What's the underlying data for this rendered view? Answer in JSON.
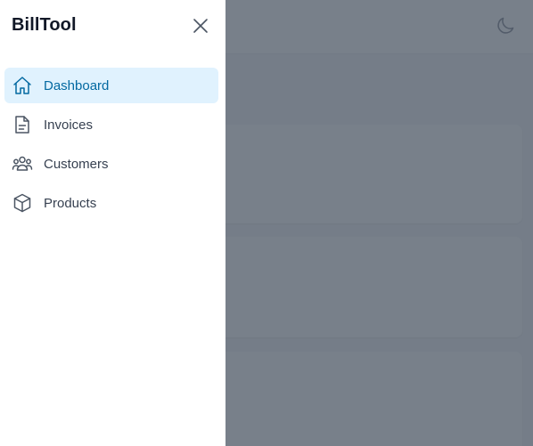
{
  "drawer": {
    "title": "BillTool",
    "close_icon": "close-icon"
  },
  "nav": {
    "items": [
      {
        "label": "Dashboard",
        "icon": "home-icon",
        "active": true
      },
      {
        "label": "Invoices",
        "icon": "document-icon",
        "active": false
      },
      {
        "label": "Customers",
        "icon": "users-icon",
        "active": false
      },
      {
        "label": "Products",
        "icon": "cube-icon",
        "active": false
      }
    ]
  },
  "header": {
    "theme_toggle_icon": "moon-icon"
  },
  "colors": {
    "accent": "#0369a1",
    "active_bg": "#e0f2fe",
    "overlay": "#4b5563"
  }
}
